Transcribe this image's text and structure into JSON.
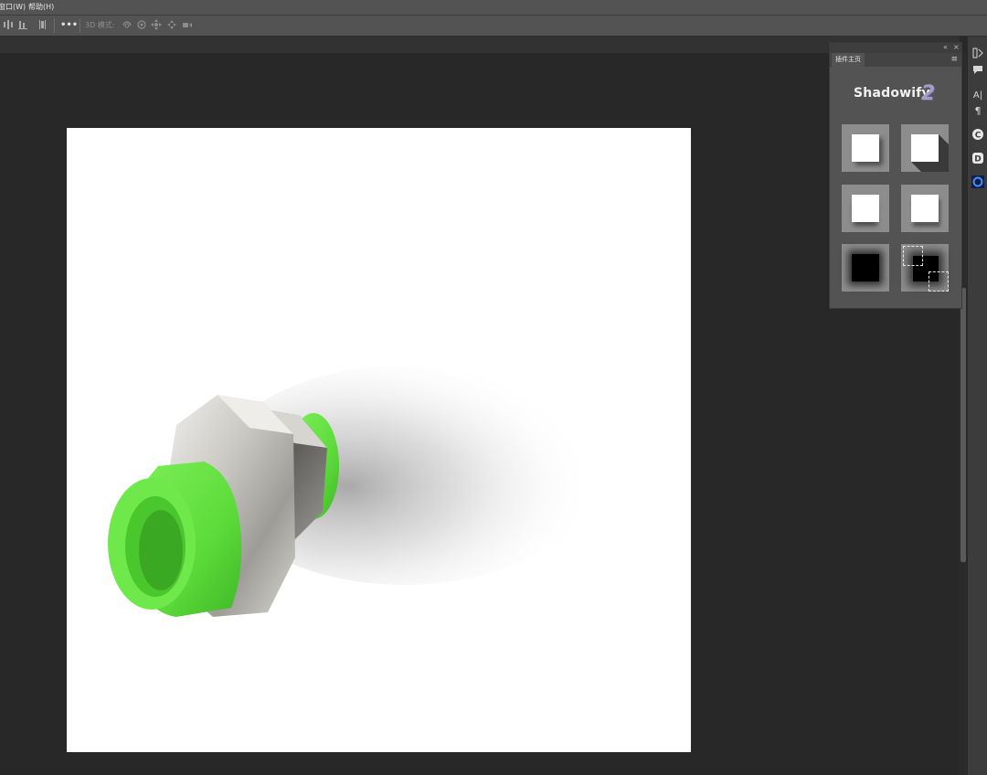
{
  "menubar": {
    "items": [
      "窗口(W)",
      "帮助(H)"
    ]
  },
  "options_bar": {
    "more_label": "•••",
    "mode_label": "3D 模式:",
    "icons": [
      "align-left-icon",
      "align-center-icon",
      "distribute-icon",
      "more-icon",
      "rotate-3d-icon",
      "roll-3d-icon",
      "drag-3d-icon",
      "slide-3d-icon",
      "scale-3d-icon"
    ]
  },
  "plugin_panel": {
    "collapse_label": "«",
    "close_label": "×",
    "tab_label": "插件主页",
    "menu_label": "≡",
    "brand_name": "Shadowify",
    "brand_badge": "2",
    "presets": [
      "drop-shadow-preset",
      "long-shadow-preset",
      "bottom-shadow-preset",
      "soft-shadow-preset",
      "inner-shadow-preset",
      "selection-shadow-preset"
    ]
  },
  "right_dock": {
    "items": [
      "history-icon",
      "comment-icon",
      "character-icon",
      "paragraph-icon",
      "plugin-c-icon",
      "plugin-d-icon",
      "plugin-ring-icon"
    ]
  },
  "colors": {
    "workspace": "#282828",
    "panel": "#535353",
    "product_green": "#5edc3c",
    "brand_badge": "#a79ec8"
  }
}
